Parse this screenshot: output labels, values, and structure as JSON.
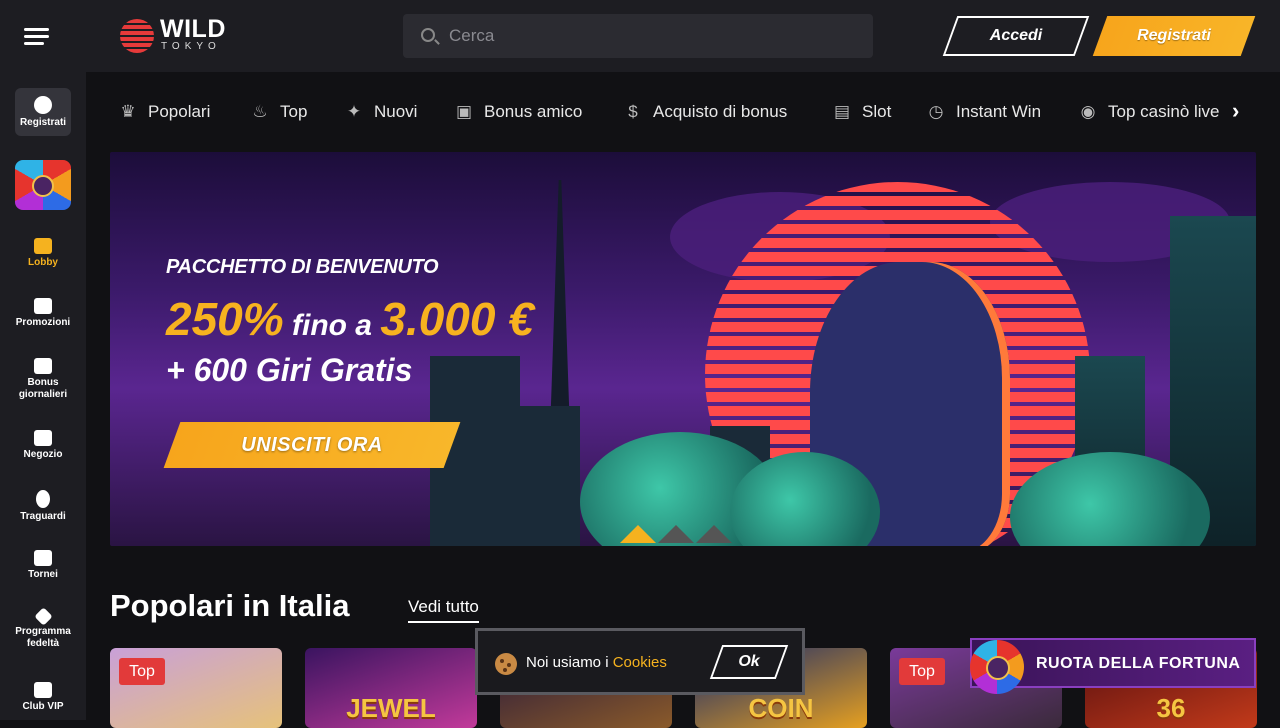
{
  "header": {
    "logo_word": "WILD",
    "logo_sub": "TOKYO",
    "search_placeholder": "Cerca",
    "login_label": "Accedi",
    "register_label": "Registrati"
  },
  "sidebar": {
    "register_label": "Registrati",
    "items": [
      {
        "label": "Lobby",
        "icon": "home-icon",
        "active": true
      },
      {
        "label": "Promozioni",
        "icon": "megaphone-icon"
      },
      {
        "label": "Bonus giornalieri",
        "icon": "calendar-icon"
      },
      {
        "label": "Negozio",
        "icon": "shop-icon"
      },
      {
        "label": "Traguardi",
        "icon": "medal-icon"
      },
      {
        "label": "Tornei",
        "icon": "trophy-icon"
      },
      {
        "label": "Programma fedeltà",
        "icon": "diamond-icon"
      },
      {
        "label": "Club VIP",
        "icon": "crown-icon"
      }
    ]
  },
  "categories": [
    {
      "label": "Popolari",
      "icon": "crown-icon"
    },
    {
      "label": "Top",
      "icon": "flame-icon"
    },
    {
      "label": "Nuovi",
      "icon": "sparkle-icon"
    },
    {
      "label": "Bonus amico",
      "icon": "gift-icon"
    },
    {
      "label": "Acquisto di bonus",
      "icon": "money-bag-icon"
    },
    {
      "label": "Slot",
      "icon": "slot-machine-icon"
    },
    {
      "label": "Instant Win",
      "icon": "stopwatch-icon"
    },
    {
      "label": "Top casinò live",
      "icon": "poker-chip-icon"
    }
  ],
  "banner": {
    "subtitle": "PACCHETTO DI BENVENUTO",
    "percent": "250%",
    "middle": " fino a ",
    "amount": "3.000 €",
    "line3": "+ 600 Giri Gratis",
    "cta": "UNISCITI ORA",
    "slides": 3,
    "active_slide": 1
  },
  "section": {
    "title": "Popolari in Italia",
    "see_all": "Vedi tutto"
  },
  "games": [
    {
      "tag": "Top",
      "title": "",
      "colors": [
        "#c9a0d8",
        "#e6c27a"
      ]
    },
    {
      "tag": "",
      "title": "JEWEL",
      "colors": [
        "#3a1460",
        "#c23a9a"
      ]
    },
    {
      "tag": "",
      "title": "",
      "colors": [
        "#2a1a3a",
        "#8a5a2a"
      ]
    },
    {
      "tag": "",
      "title": "COIN",
      "colors": [
        "#1a2a6a",
        "#e6a020"
      ]
    },
    {
      "tag": "Top",
      "title": "",
      "colors": [
        "#7a3a9a",
        "#3a2a3a"
      ]
    },
    {
      "tag": "",
      "title": "36",
      "colors": [
        "#5a1010",
        "#c23a1a"
      ]
    }
  ],
  "cookie": {
    "text": "Noi usiamo i ",
    "link": "Cookies",
    "ok": "Ok"
  },
  "wheel_promo": {
    "label": "RUOTA DELLA FORTUNA"
  },
  "colors": {
    "accent": "#f5b21f",
    "background": "#111114",
    "panel": "#1d1d22"
  }
}
